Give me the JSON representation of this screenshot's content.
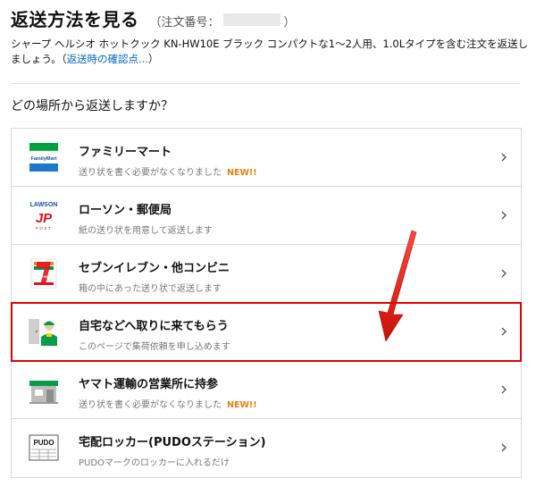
{
  "header": {
    "title": "返送方法を見る",
    "order_label": "（注文番号：",
    "order_close": "）",
    "description_text": "シャープ ヘルシオ ホットクック KN-HW10E ブラック コンパクトな1〜2人用、1.0Lタイプを含む注文を返送しましょう。（",
    "description_link": "返送時の確認点...",
    "description_end": "）"
  },
  "question": "どの場所から返送しますか？",
  "options": [
    {
      "title": "ファミリーマート",
      "subtitle": "送り状を書く必要がなくなりました",
      "badge": "NEW!!",
      "logo": "familymart-logo",
      "logo_text": "FamilyMart"
    },
    {
      "title": "ローソン・郵便局",
      "subtitle": "紙の送り状を用意して返送します",
      "badge": "",
      "logo": "lawson-jp-logo",
      "logo_text": "LAWSON",
      "logo_text2": "JP",
      "logo_text3": "POST"
    },
    {
      "title": "セブンイレブン・他コンビニ",
      "subtitle": "箱の中にあった送り状で返送します",
      "badge": "",
      "logo": "seven-eleven-logo",
      "logo_text": "ELEVEN"
    },
    {
      "title": "自宅などへ取りに来てもらう",
      "subtitle": "このページで集荷依頼を申し込めます",
      "badge": "",
      "logo": "pickup-courier-icon"
    },
    {
      "title": "ヤマト運輸の営業所に持参",
      "subtitle": "送り状を書く必要がなくなりました",
      "badge": "NEW!!",
      "logo": "yamato-office-icon"
    },
    {
      "title": "宅配ロッカー(PUDOステーション)",
      "subtitle": "PUDOマークのロッカーに入れるだけ",
      "badge": "",
      "logo": "pudo-logo",
      "logo_text": "PUDO"
    }
  ],
  "colors": {
    "link": "#0066c0",
    "highlight": "#e00000",
    "new_badge": "#e8810c",
    "arrow": "#e8150f"
  }
}
